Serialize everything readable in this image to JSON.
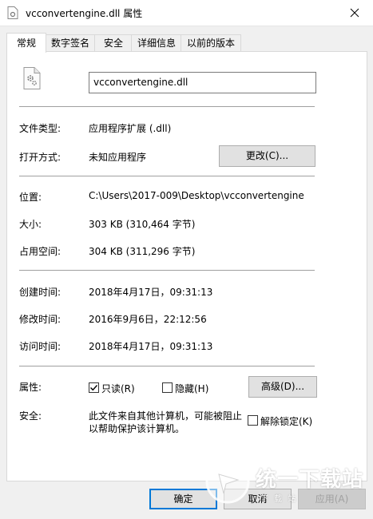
{
  "window": {
    "title": "vcconvertengine.dll 属性",
    "close_icon": "close-icon"
  },
  "tabs": [
    {
      "label": "常规",
      "active": true
    },
    {
      "label": "数字签名",
      "active": false
    },
    {
      "label": "安全",
      "active": false
    },
    {
      "label": "详细信息",
      "active": false
    },
    {
      "label": "以前的版本",
      "active": false
    }
  ],
  "general": {
    "file_icon": "dll-gear-file-icon",
    "filename": "vcconvertengine.dll",
    "type_label": "文件类型:",
    "type_value": "应用程序扩展 (.dll)",
    "opens_with_label": "打开方式:",
    "opens_with_value": "未知应用程序",
    "change_button": "更改(C)...",
    "location_label": "位置:",
    "location_value": "C:\\Users\\2017-009\\Desktop\\vcconvertengine",
    "size_label": "大小:",
    "size_value": "303 KB (310,464 字节)",
    "size_on_disk_label": "占用空间:",
    "size_on_disk_value": "304 KB (311,296 字节)",
    "created_label": "创建时间:",
    "created_value": "2018年4月17日，09:31:13",
    "modified_label": "修改时间:",
    "modified_value": "2016年9月6日，22:12:56",
    "accessed_label": "访问时间:",
    "accessed_value": "2018年4月17日，09:31:13",
    "attributes_label": "属性:",
    "readonly_label": "只读(R)",
    "readonly_checked": true,
    "hidden_label": "隐藏(H)",
    "hidden_checked": false,
    "advanced_button": "高级(D)...",
    "security_label": "安全:",
    "security_text_line1": "此文件来自其他计算机，可能被阻止",
    "security_text_line2": "以帮助保护该计算机。",
    "unblock_label": "解除锁定(K)",
    "unblock_checked": false
  },
  "footer": {
    "ok": "确定",
    "cancel": "取消",
    "apply": "应用(A)"
  },
  "watermark": {
    "text": "统一下载站",
    "sub": "下 载 站"
  }
}
